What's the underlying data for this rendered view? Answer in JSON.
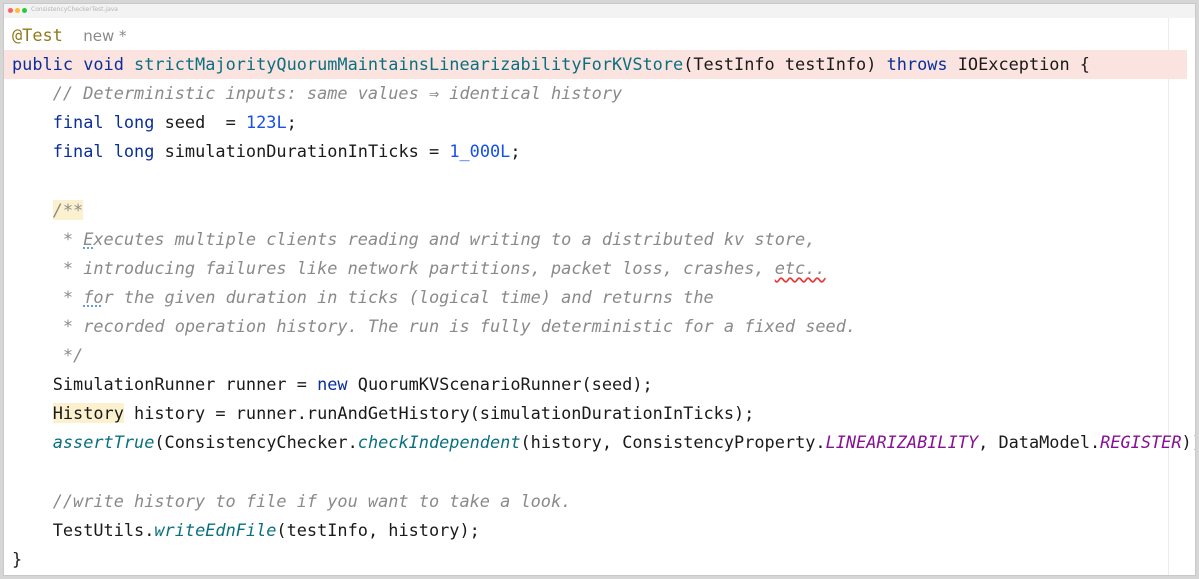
{
  "window": {
    "tab_title": "ConsistencyCheckerTest.java"
  },
  "editor": {
    "annotation": "@Test",
    "new_marker": "new *",
    "sig_public": "public",
    "sig_void": "void",
    "sig_method_name": "strictMajorityQuorumMaintainsLinearizabilityForKVStore",
    "sig_params": "(TestInfo testInfo)",
    "sig_throws": "throws",
    "sig_exception": "IOException {",
    "comment_deterministic": "// Deterministic inputs: same values ⇒ identical history",
    "kw_final": "final",
    "kw_long": "long",
    "seed_decl": "seed  = ",
    "seed_value": "123L",
    "duration_decl": "simulationDurationInTicks = ",
    "duration_value": "1_000L",
    "javadoc_open": "/**",
    "javadoc_star": "*",
    "javadoc_l1_first": "E",
    "javadoc_l1_rest": "xecutes multiple clients reading and writing to a distributed kv store,",
    "javadoc_l2": "introducing failures like network partitions, packet loss, crashes, ",
    "javadoc_l2_etc": "etc..",
    "javadoc_l3_first": "fo",
    "javadoc_l3_rest": "r the given duration in ticks (logical time) and returns the",
    "javadoc_l4": "recorded operation history. The run is fully deterministic for a fixed seed.",
    "javadoc_close": "*/",
    "runner_decl": "SimulationRunner runner = ",
    "kw_new": "new",
    "runner_init": " QuorumKVScenarioRunner(seed);",
    "history_type": "History",
    "history_rest": " history = runner.runAndGetHistory(simulationDurationInTicks);",
    "assert_fn": "assertTrue",
    "assert_class": "(ConsistencyChecker.",
    "assert_method": "checkIndependent",
    "assert_args1": "(history, ConsistencyProperty.",
    "assert_lin": "LINEARIZABILITY",
    "assert_args2": ", DataModel.",
    "assert_reg": "REGISTER",
    "assert_end": "));",
    "comment_write": "//write history to file if you want to take a look.",
    "testutils_class": "TestUtils.",
    "testutils_method": "writeEdnFile",
    "testutils_args": "(testInfo, history);",
    "closing_brace": "}"
  },
  "colors": {
    "keyword": "#0b2f9a",
    "annotation": "#8f7a1d",
    "comment": "#8a8a8a",
    "number": "#1750eb",
    "static_field": "#871094",
    "method_call": "#0a7080",
    "highlighted_line": "#fbe3e0"
  }
}
